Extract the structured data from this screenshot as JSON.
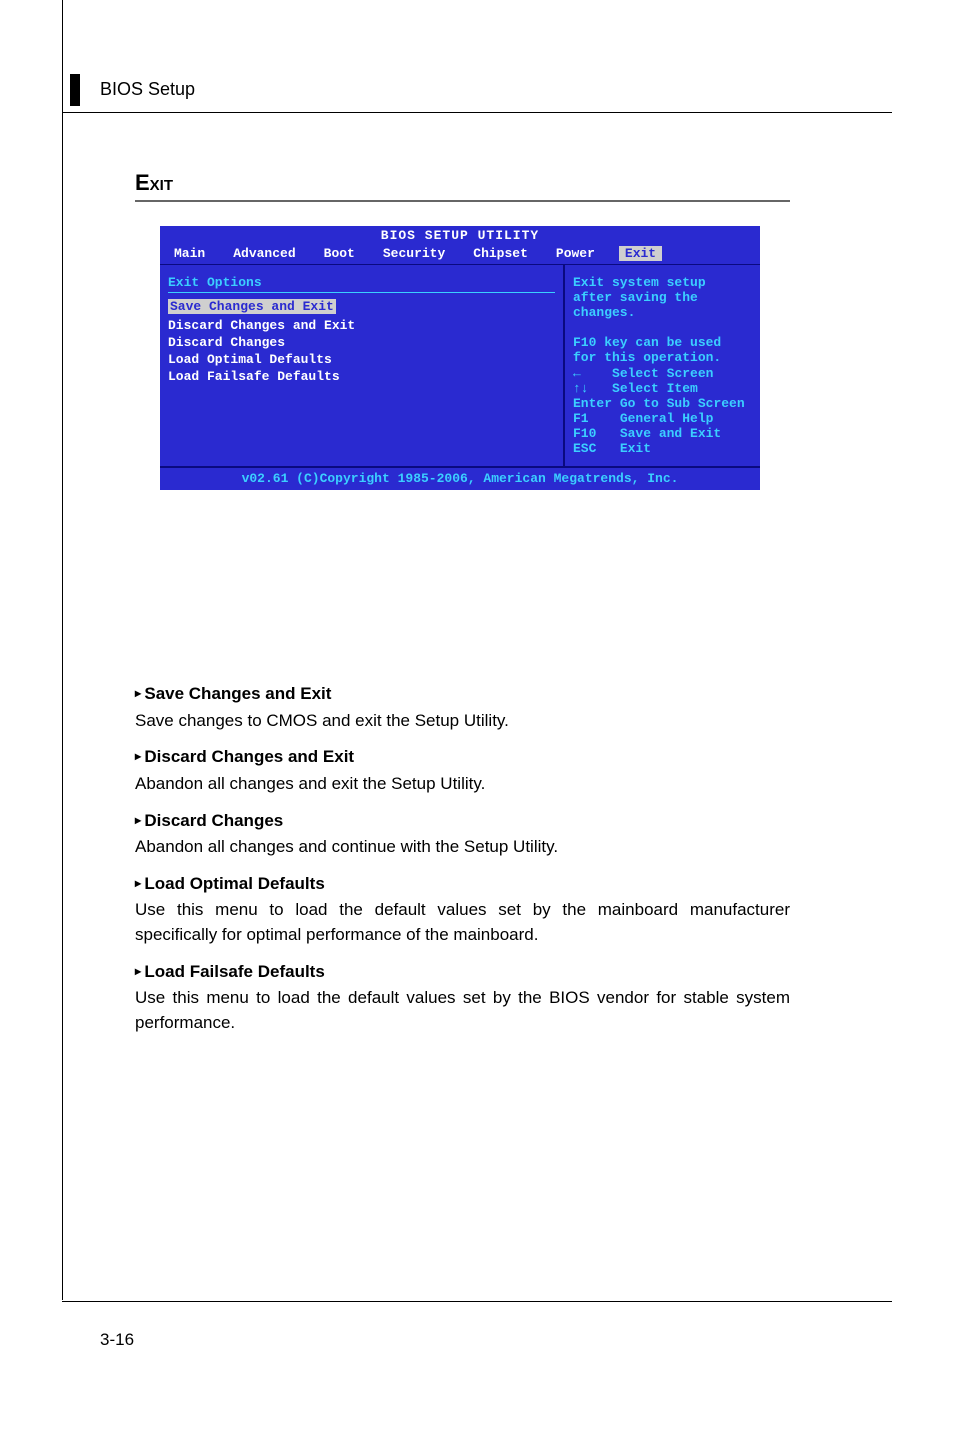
{
  "header": {
    "title": "BIOS Setup"
  },
  "section": {
    "title": "Exit"
  },
  "bios": {
    "window_title": "BIOS SETUP UTILITY",
    "tabs": [
      "Main",
      "Advanced",
      "Boot",
      "Security",
      "Chipset",
      "Power",
      "Exit"
    ],
    "panel_heading": "Exit Options",
    "items": [
      "Save Changes and Exit",
      "Discard Changes and Exit",
      "Discard Changes",
      "",
      "Load Optimal Defaults",
      "Load Failsafe Defaults"
    ],
    "help": {
      "text": "Exit system setup after saving the changes.\n\nF10 key can be used for this operation.",
      "keys": [
        {
          "key": "←",
          "label": "Select Screen"
        },
        {
          "key": "↑↓",
          "label": "Select Item"
        },
        {
          "key": "Enter",
          "label": "Go to Sub Screen"
        },
        {
          "key": "F1",
          "label": "General Help"
        },
        {
          "key": "F10",
          "label": "Save and Exit"
        },
        {
          "key": "ESC",
          "label": "Exit"
        }
      ]
    },
    "footer": "v02.61 (C)Copyright 1985-2006, American Megatrends, Inc."
  },
  "doc": {
    "items": [
      {
        "title": "Save Changes and Exit",
        "body": "Save changes to CMOS and exit the Setup Utility."
      },
      {
        "title": "Discard Changes and Exit",
        "body": "Abandon all changes and exit the Setup Utility."
      },
      {
        "title": "Discard Changes",
        "body": "Abandon all changes and continue with the Setup Utility."
      },
      {
        "title": "Load Optimal Defaults",
        "body": "Use this menu to load the default values set by the mainboard manufacturer specifically for optimal performance of the mainboard."
      },
      {
        "title": "Load Failsafe Defaults",
        "body": "Use this menu to load the default values set by the BIOS vendor for stable system performance."
      }
    ]
  },
  "page_number": "3-16"
}
